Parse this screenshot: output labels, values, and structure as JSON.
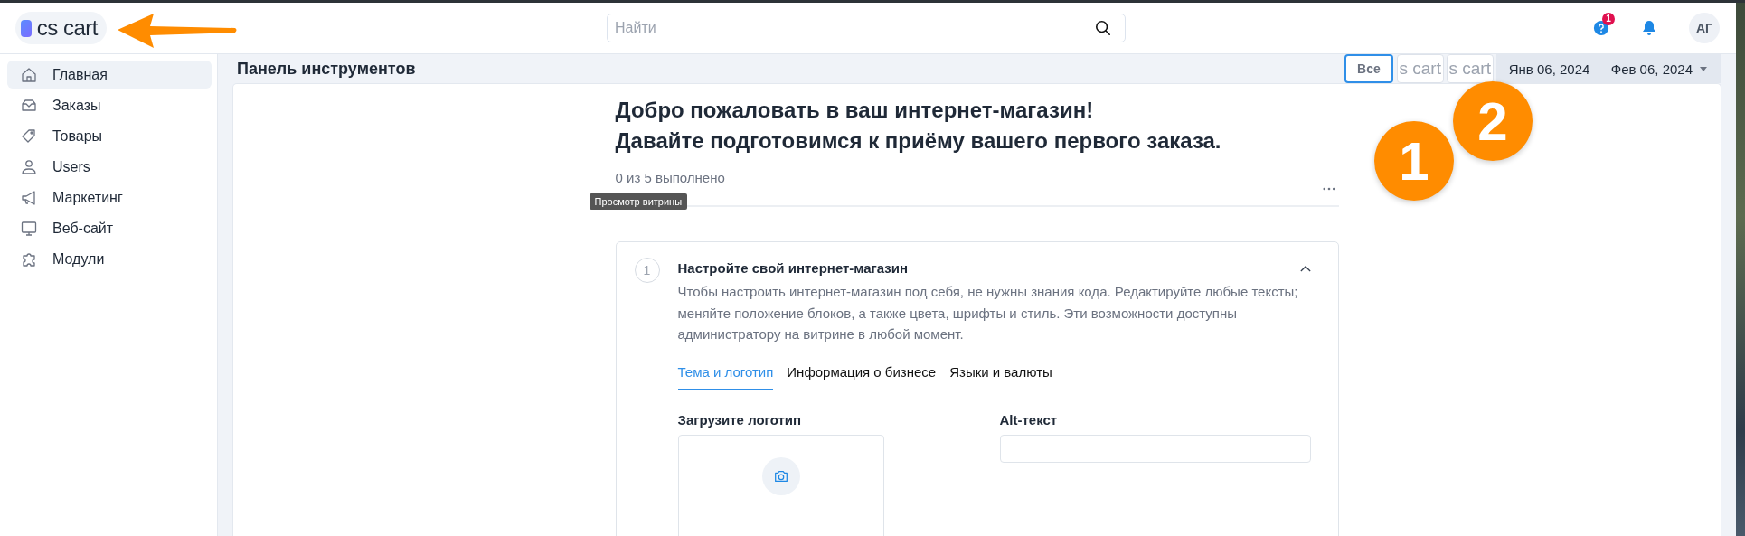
{
  "logo": {
    "text": "cs cart"
  },
  "search": {
    "placeholder": "Найти"
  },
  "header": {
    "help_badge": "1",
    "avatar": "АГ"
  },
  "sidebar": {
    "items": [
      {
        "label": "Главная",
        "selected": true
      },
      {
        "label": "Заказы",
        "selected": false
      },
      {
        "label": "Товары",
        "selected": false
      },
      {
        "label": "Users",
        "selected": false
      },
      {
        "label": "Маркетинг",
        "selected": false
      },
      {
        "label": "Веб-сайт",
        "selected": false
      },
      {
        "label": "Модули",
        "selected": false
      }
    ]
  },
  "page_title": "Панель инструментов",
  "filter_buttons": [
    {
      "label": "Все",
      "selected": true
    },
    {
      "label": "s cart",
      "selected": false
    },
    {
      "label": "s cart",
      "selected": false
    }
  ],
  "date_range": "Янв 06, 2024 — Фев 06, 2024",
  "welcome": {
    "title_lines": [
      "Добро пожаловать в ваш интернет-магазин!",
      "Давайте подготовимся к приёму вашего первого заказа."
    ],
    "progress": "0 из 5 выполнено",
    "tooltip": "Просмотр витрины"
  },
  "step": {
    "number": "1",
    "title": "Настройте свой интернет-магазин",
    "expanded": true,
    "description": "Чтобы настроить интернет-магазин под себя, не нужны знания кода. Редактируйте любые тексты; меняйте положение блоков, а также цвета, шрифты и стиль. Эти возможности доступны администратору на витрине в любой момент.",
    "tabs": [
      {
        "label": "Тема и логотип",
        "selected": true
      },
      {
        "label": "Информация о бизнесе",
        "selected": false
      },
      {
        "label": "Языки и валюты",
        "selected": false
      }
    ],
    "logo_upload_label": "Загрузите логотип",
    "alt_text_label": "Alt-текст"
  },
  "markers": [
    {
      "label": "1"
    },
    {
      "label": "2"
    }
  ]
}
